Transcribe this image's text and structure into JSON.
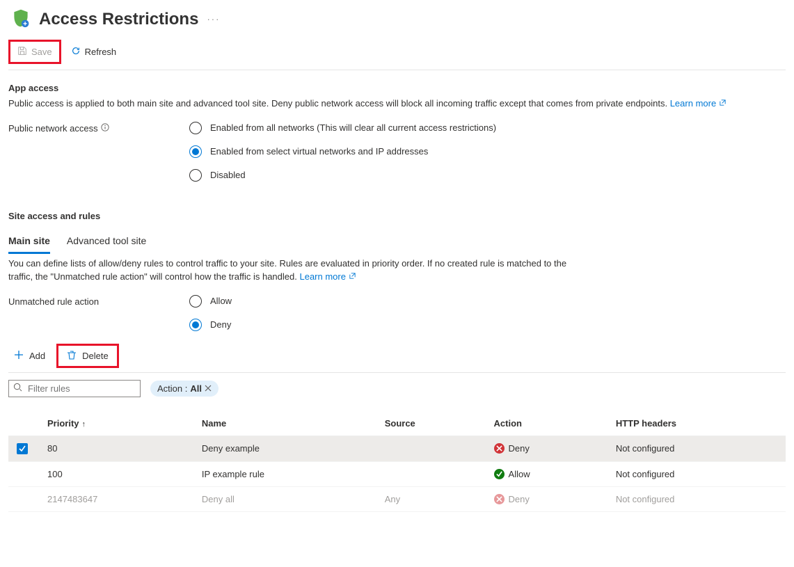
{
  "header": {
    "title": "Access Restrictions"
  },
  "toolbar": {
    "save": "Save",
    "refresh": "Refresh"
  },
  "app_access": {
    "heading": "App access",
    "description": "Public access is applied to both main site and advanced tool site. Deny public network access will block all incoming traffic except that comes from private endpoints.",
    "learn_more": "Learn more",
    "label": "Public network access",
    "options": {
      "enabled_all": "Enabled from all networks (This will clear all current access restrictions)",
      "enabled_select": "Enabled from select virtual networks and IP addresses",
      "disabled": "Disabled"
    }
  },
  "site_access": {
    "heading": "Site access and rules",
    "tabs": {
      "main": "Main site",
      "advanced": "Advanced tool site"
    },
    "description": "You can define lists of allow/deny rules to control traffic to your site. Rules are evaluated in priority order. If no created rule is matched to the traffic, the \"Unmatched rule action\" will control how the traffic is handled.",
    "learn_more": "Learn more",
    "unmatched_label": "Unmatched rule action",
    "unmatched_options": {
      "allow": "Allow",
      "deny": "Deny"
    }
  },
  "rules_toolbar": {
    "add": "Add",
    "delete": "Delete"
  },
  "filter": {
    "placeholder": "Filter rules",
    "pill_label": "Action :",
    "pill_value": "All"
  },
  "table": {
    "cols": {
      "priority": "Priority",
      "name": "Name",
      "source": "Source",
      "action": "Action",
      "http": "HTTP headers"
    },
    "rows": [
      {
        "selected": true,
        "priority": "80",
        "name": "Deny example",
        "source": "",
        "action": "Deny",
        "http": "Not configured",
        "muted": false
      },
      {
        "selected": false,
        "priority": "100",
        "name": "IP example rule",
        "source": "",
        "action": "Allow",
        "http": "Not configured",
        "muted": false
      },
      {
        "selected": false,
        "priority": "2147483647",
        "name": "Deny all",
        "source": "Any",
        "action": "Deny",
        "http": "Not configured",
        "muted": true
      }
    ]
  }
}
